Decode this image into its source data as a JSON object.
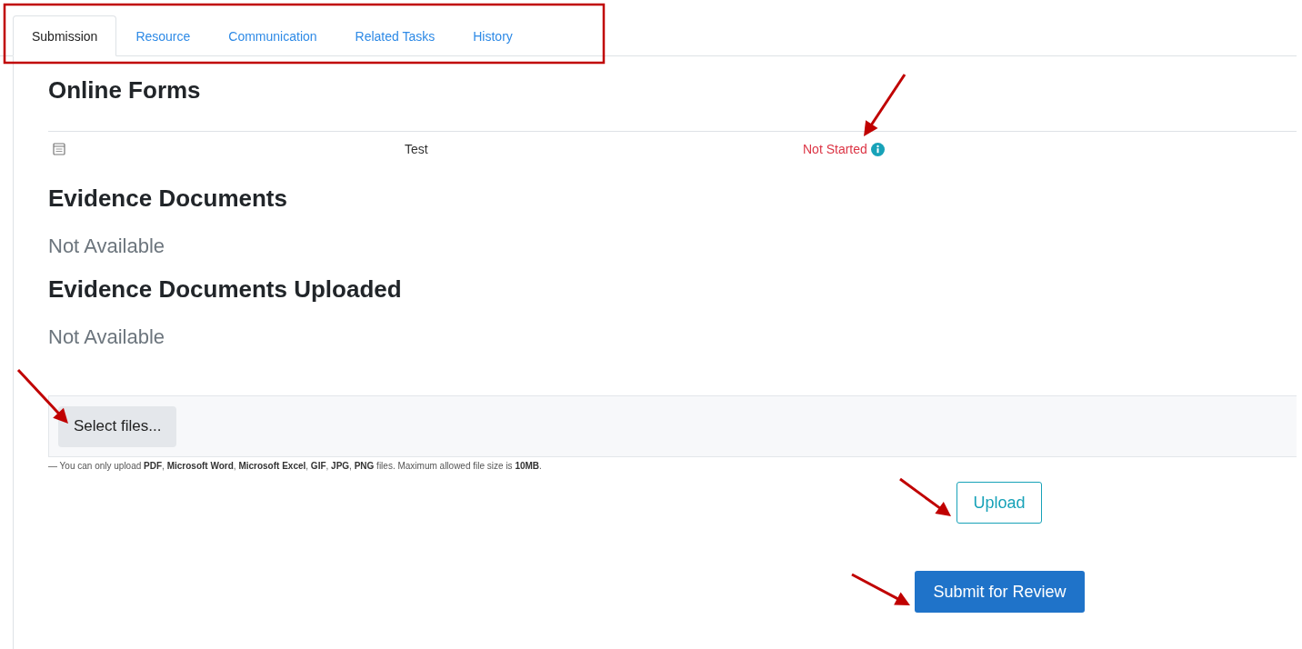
{
  "tabs": [
    {
      "label": "Submission",
      "selected": true
    },
    {
      "label": "Resource",
      "selected": false
    },
    {
      "label": "Communication",
      "selected": false
    },
    {
      "label": "Related Tasks",
      "selected": false
    },
    {
      "label": "History",
      "selected": false
    }
  ],
  "online_forms": {
    "title": "Online Forms",
    "rows": [
      {
        "name": "Test",
        "status": "Not Started"
      }
    ]
  },
  "evidence_documents": {
    "title": "Evidence Documents",
    "empty_text": "Not Available"
  },
  "evidence_documents_uploaded": {
    "title": "Evidence Documents Uploaded",
    "empty_text": "Not Available"
  },
  "upload": {
    "select_button": "Select files...",
    "note": "—  You can only upload **PDF**, **Microsoft Word**, **Microsoft Excel**, **GIF**, **JPG**, **PNG** files. Maximum allowed file size is **10MB**.",
    "upload_button": "Upload"
  },
  "submit_button": "Submit for Review"
}
